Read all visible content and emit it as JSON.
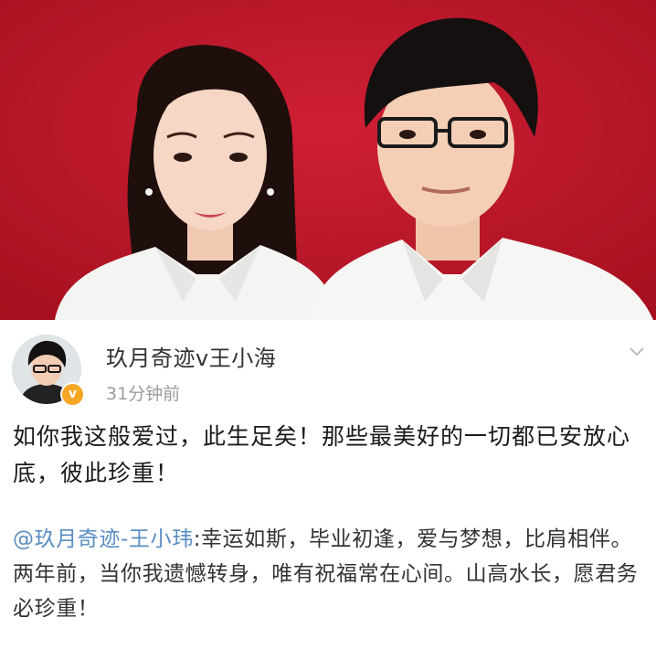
{
  "photo": {
    "background_color": "#c0172c"
  },
  "post": {
    "username": "玖月奇迹v王小海",
    "time": "31分钟前",
    "verified_badge": "v",
    "verified_color": "#f5a623",
    "text": "如你我这般爱过，此生足矣！那些最美好的一切都已安放心底，彼此珍重！",
    "menu_icon": "chevron-down-icon"
  },
  "repost": {
    "mention": "@玖月奇迹-王小玮",
    "text": ":幸运如斯，毕业初逢，爱与梦想，比肩相伴。两年前，当你我遗憾转身，唯有祝福常在心间。山高水长，愿君务必珍重！",
    "mention_color": "#5a8dc2"
  }
}
